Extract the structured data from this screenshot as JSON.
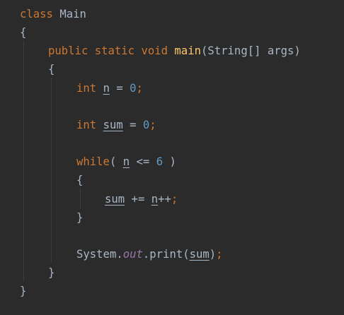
{
  "code": {
    "class_kw": "class",
    "class_name": "Main",
    "brace_open": "{",
    "brace_close": "}",
    "public_kw": "public",
    "static_kw": "static",
    "void_kw": "void",
    "main_method": "main",
    "main_params": "(String[] args)",
    "int_kw": "int",
    "var_n": "n",
    "var_sum": "sum",
    "assign": " = ",
    "zero": "0",
    "semicolon": ";",
    "while_kw": "while",
    "while_open": "( ",
    "le_op": " <= ",
    "six": "6",
    "while_close": " )",
    "plus_eq": " += ",
    "incr": "++",
    "system": "System.",
    "out_field": "out",
    "print_call": ".print(",
    "close_paren": ")"
  }
}
